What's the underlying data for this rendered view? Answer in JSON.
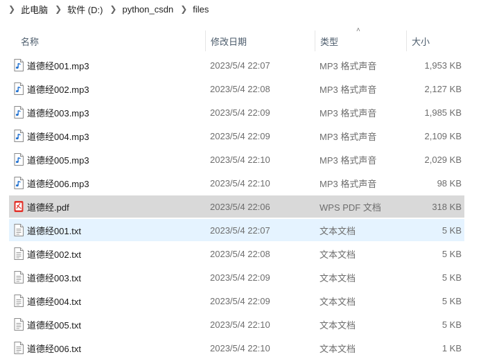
{
  "breadcrumb": [
    "此电脑",
    "软件 (D:)",
    "python_csdn",
    "files"
  ],
  "columns": {
    "name": "名称",
    "date": "修改日期",
    "type": "类型",
    "size": "大小"
  },
  "files": [
    {
      "name": "道德经001.mp3",
      "date": "2023/5/4 22:07",
      "type": "MP3 格式声音",
      "size": "1,953 KB",
      "icon": "audio-file-icon"
    },
    {
      "name": "道德经002.mp3",
      "date": "2023/5/4 22:08",
      "type": "MP3 格式声音",
      "size": "2,127 KB",
      "icon": "audio-file-icon"
    },
    {
      "name": "道德经003.mp3",
      "date": "2023/5/4 22:09",
      "type": "MP3 格式声音",
      "size": "1,985 KB",
      "icon": "audio-file-icon"
    },
    {
      "name": "道德经004.mp3",
      "date": "2023/5/4 22:09",
      "type": "MP3 格式声音",
      "size": "2,109 KB",
      "icon": "audio-file-icon"
    },
    {
      "name": "道德经005.mp3",
      "date": "2023/5/4 22:10",
      "type": "MP3 格式声音",
      "size": "2,029 KB",
      "icon": "audio-file-icon"
    },
    {
      "name": "道德经006.mp3",
      "date": "2023/5/4 22:10",
      "type": "MP3 格式声音",
      "size": "98 KB",
      "icon": "audio-file-icon"
    },
    {
      "name": "道德经.pdf",
      "date": "2023/5/4 22:06",
      "type": "WPS PDF 文档",
      "size": "318 KB",
      "icon": "pdf-file-icon"
    },
    {
      "name": "道德经001.txt",
      "date": "2023/5/4 22:07",
      "type": "文本文档",
      "size": "5 KB",
      "icon": "text-file-icon"
    },
    {
      "name": "道德经002.txt",
      "date": "2023/5/4 22:08",
      "type": "文本文档",
      "size": "5 KB",
      "icon": "text-file-icon"
    },
    {
      "name": "道德经003.txt",
      "date": "2023/5/4 22:09",
      "type": "文本文档",
      "size": "5 KB",
      "icon": "text-file-icon"
    },
    {
      "name": "道德经004.txt",
      "date": "2023/5/4 22:09",
      "type": "文本文档",
      "size": "5 KB",
      "icon": "text-file-icon"
    },
    {
      "name": "道德经005.txt",
      "date": "2023/5/4 22:10",
      "type": "文本文档",
      "size": "5 KB",
      "icon": "text-file-icon"
    },
    {
      "name": "道德经006.txt",
      "date": "2023/5/4 22:10",
      "type": "文本文档",
      "size": "1 KB",
      "icon": "text-file-icon"
    }
  ],
  "selected_index": 6,
  "hover_index": 7,
  "colors": {
    "selected": "#d9d9d9",
    "hover": "#e5f3ff",
    "audio": "#1e6fd0",
    "pdf": "#e2322a"
  }
}
